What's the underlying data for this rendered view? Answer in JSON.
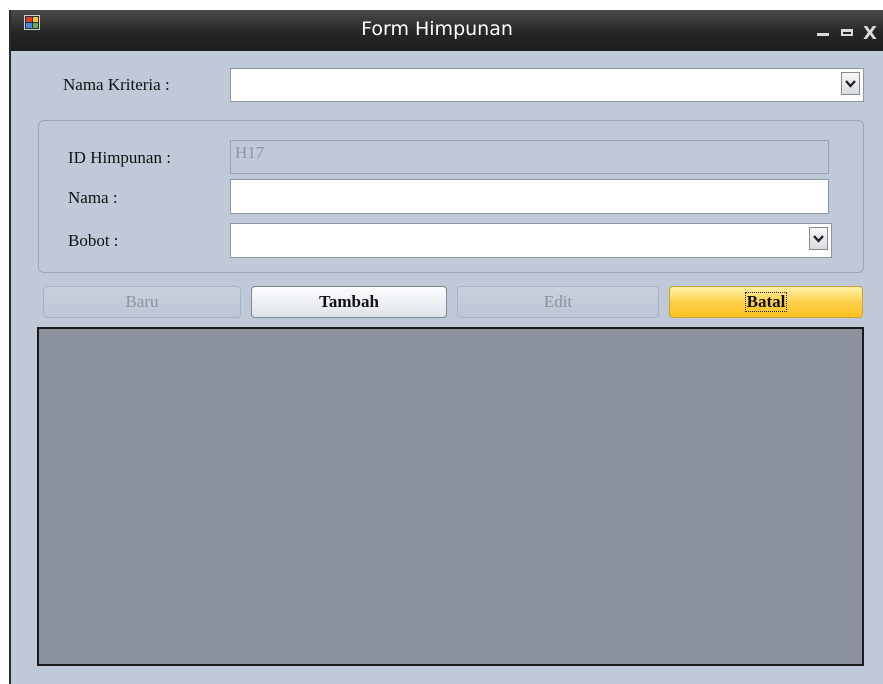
{
  "window": {
    "title": "Form Himpunan",
    "icons": {
      "app": "app-icon",
      "minimize": "minimize-icon",
      "maximize": "maximize-icon",
      "close": "close-icon"
    },
    "close_glyph": "X"
  },
  "form": {
    "nama_kriteria": {
      "label": "Nama Kriteria :",
      "value": ""
    },
    "id_himpunan": {
      "label": "ID Himpunan :",
      "value": "H17"
    },
    "nama": {
      "label": "Nama :",
      "value": ""
    },
    "bobot": {
      "label": "Bobot :",
      "value": ""
    }
  },
  "buttons": {
    "baru": "Baru",
    "tambah": "Tambah",
    "edit": "Edit",
    "batal": "Batal"
  },
  "colors": {
    "form_background": "#bfc9d8",
    "grid_background": "#8b929e",
    "active_button": "#ffc21f"
  }
}
